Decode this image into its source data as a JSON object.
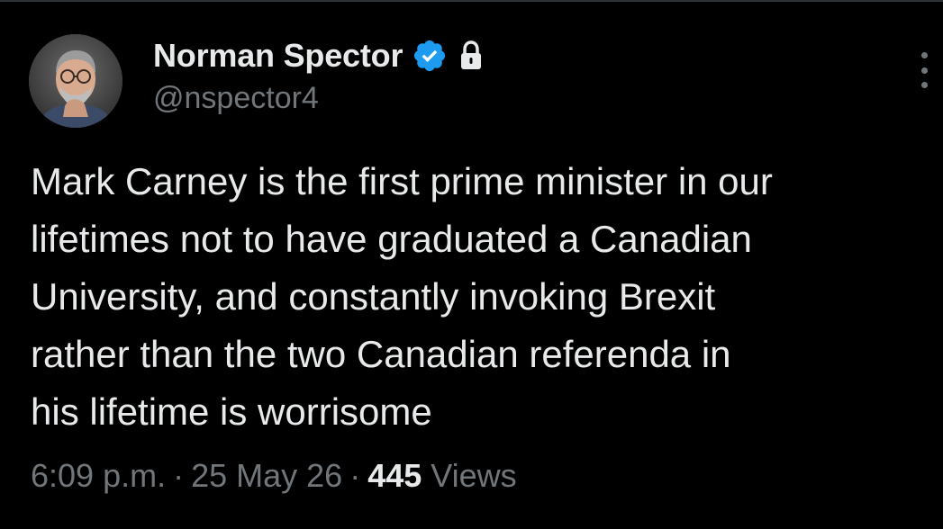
{
  "author": {
    "display_name": "Norman Spector",
    "handle": "@nspector4",
    "avatar_icon": "profile-photo-icon",
    "verified_icon": "verified-badge-icon",
    "verified_color": "#1d9bf0",
    "protected_icon": "lock-icon"
  },
  "menu": {
    "icon": "more-vertical-icon"
  },
  "tweet": {
    "lines": [
      "Mark Carney is the first prime minister in our",
      "lifetimes not to have graduated a Canadian",
      "University, and constantly invoking Brexit",
      "rather than the two Canadian referenda in",
      "his lifetime is worrisome"
    ]
  },
  "meta": {
    "time": "6:09 p.m.",
    "separator": "·",
    "date": "25 May 26",
    "views_count": "445",
    "views_label": "Views"
  },
  "colors": {
    "background": "#000000",
    "primary_text": "#e7e9ea",
    "secondary_text": "#71767b",
    "accent": "#1d9bf0"
  }
}
